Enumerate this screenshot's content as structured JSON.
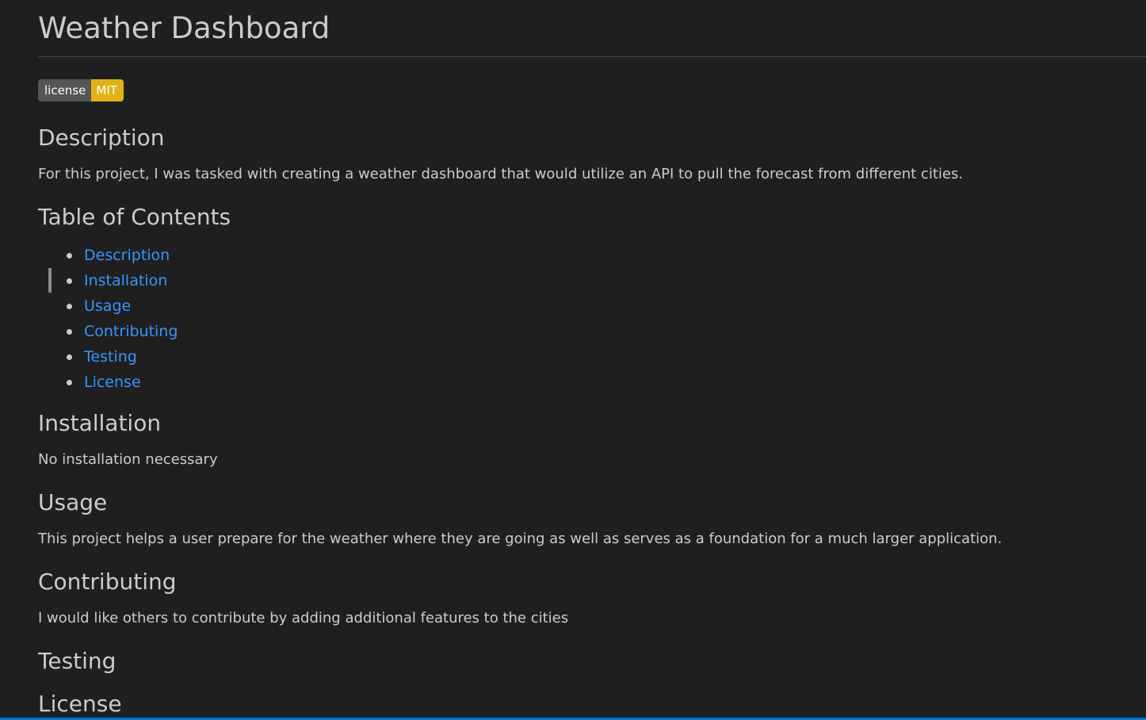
{
  "title": "Weather Dashboard",
  "badge": {
    "label": "license",
    "value": "MIT"
  },
  "sections": {
    "description": {
      "heading": "Description",
      "text": "For this project, I was tasked with creating a weather dashboard that would utilize an API to pull the forecast from different cities."
    },
    "toc": {
      "heading": "Table of Contents",
      "items": [
        {
          "label": "Description"
        },
        {
          "label": "Installation"
        },
        {
          "label": "Usage"
        },
        {
          "label": "Contributing"
        },
        {
          "label": "Testing"
        },
        {
          "label": "License"
        }
      ]
    },
    "installation": {
      "heading": "Installation",
      "text": "No installation necessary"
    },
    "usage": {
      "heading": "Usage",
      "text": "This project helps a user prepare for the weather where they are going as well as serves as a foundation for a much larger application."
    },
    "contributing": {
      "heading": "Contributing",
      "text": "I would like others to contribute by adding additional features to the cities"
    },
    "testing": {
      "heading": "Testing"
    },
    "license": {
      "heading": "License"
    }
  },
  "colors": {
    "background": "#1f1f1f",
    "text": "#cccccc",
    "link": "#3794ff",
    "badge_left": "#555555",
    "badge_right": "#dfb317",
    "status_bar": "#0078d4"
  }
}
